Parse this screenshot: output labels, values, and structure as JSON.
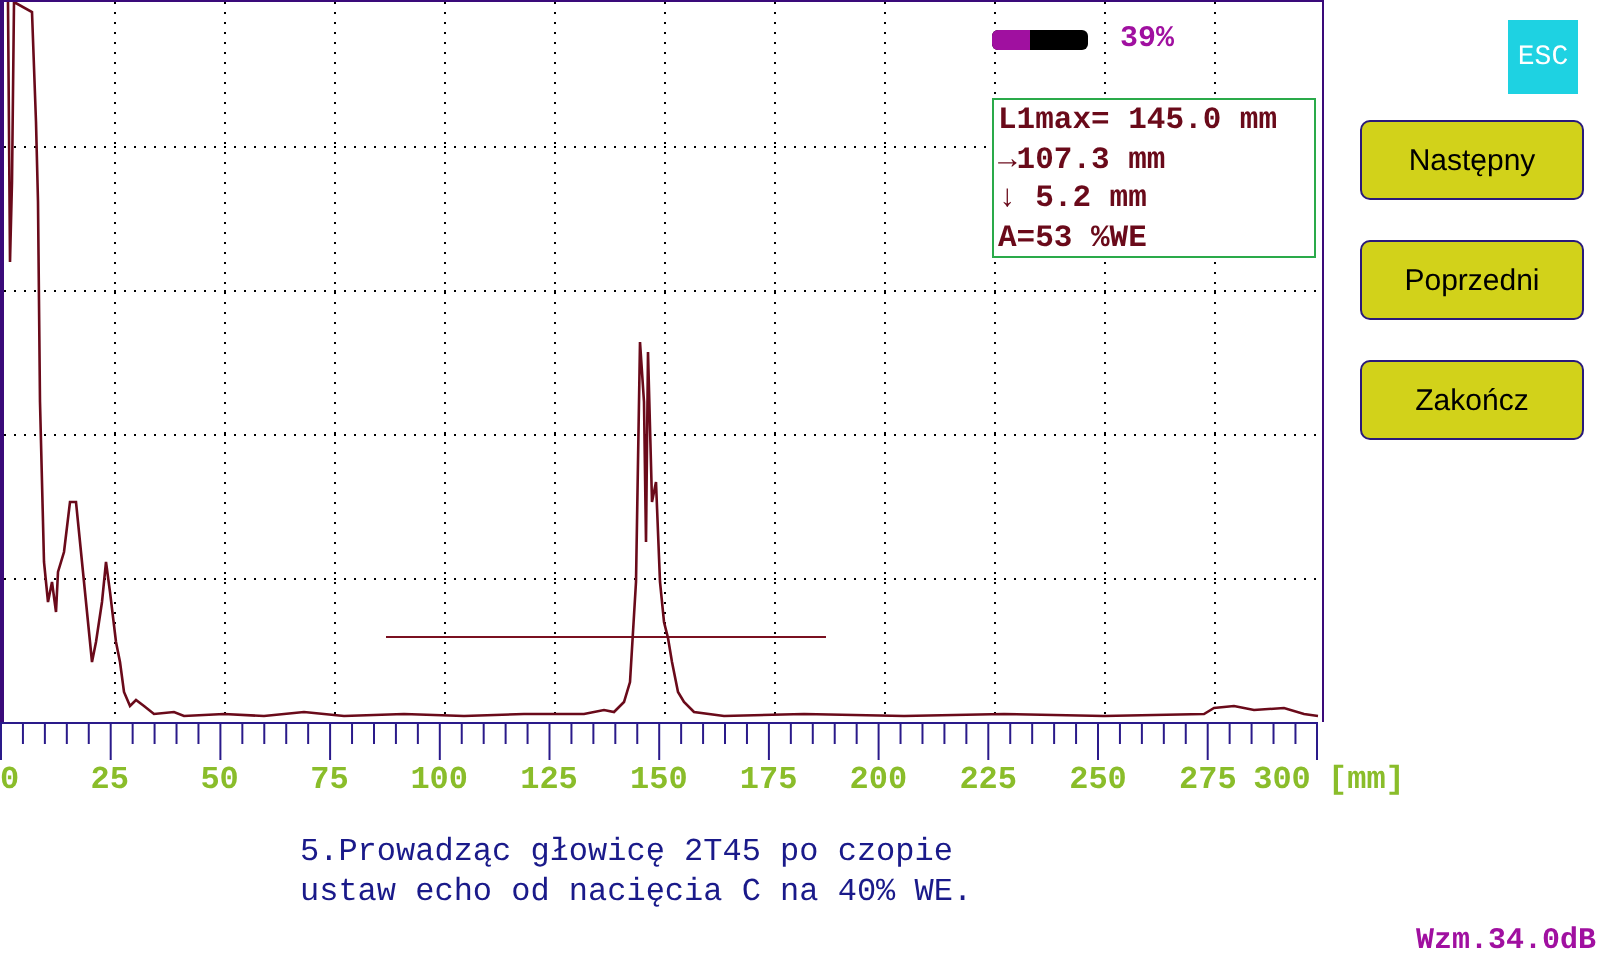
{
  "battery": {
    "level": 0.39,
    "reading": "39%"
  },
  "readings": [
    "L1max= 145.0 mm",
    "→107.3 mm",
    "↓ 5.2 mm",
    "A=53 %WE"
  ],
  "esc_button": "ESC",
  "buttons": [
    "Następny",
    "Poprzedni",
    "Zakończ"
  ],
  "axis": {
    "labels": [
      "0",
      "25",
      "50",
      "75",
      "100",
      "125",
      "150",
      "175",
      "200",
      "225",
      "250",
      "275",
      "300"
    ],
    "unit": "[mm]"
  },
  "instruction": [
    "5.Prowadząc głowicę 2T45 po czopie",
    "ustaw echo od nacięcia C na 40% WE."
  ],
  "gain": "Wzm.34.0dB"
}
